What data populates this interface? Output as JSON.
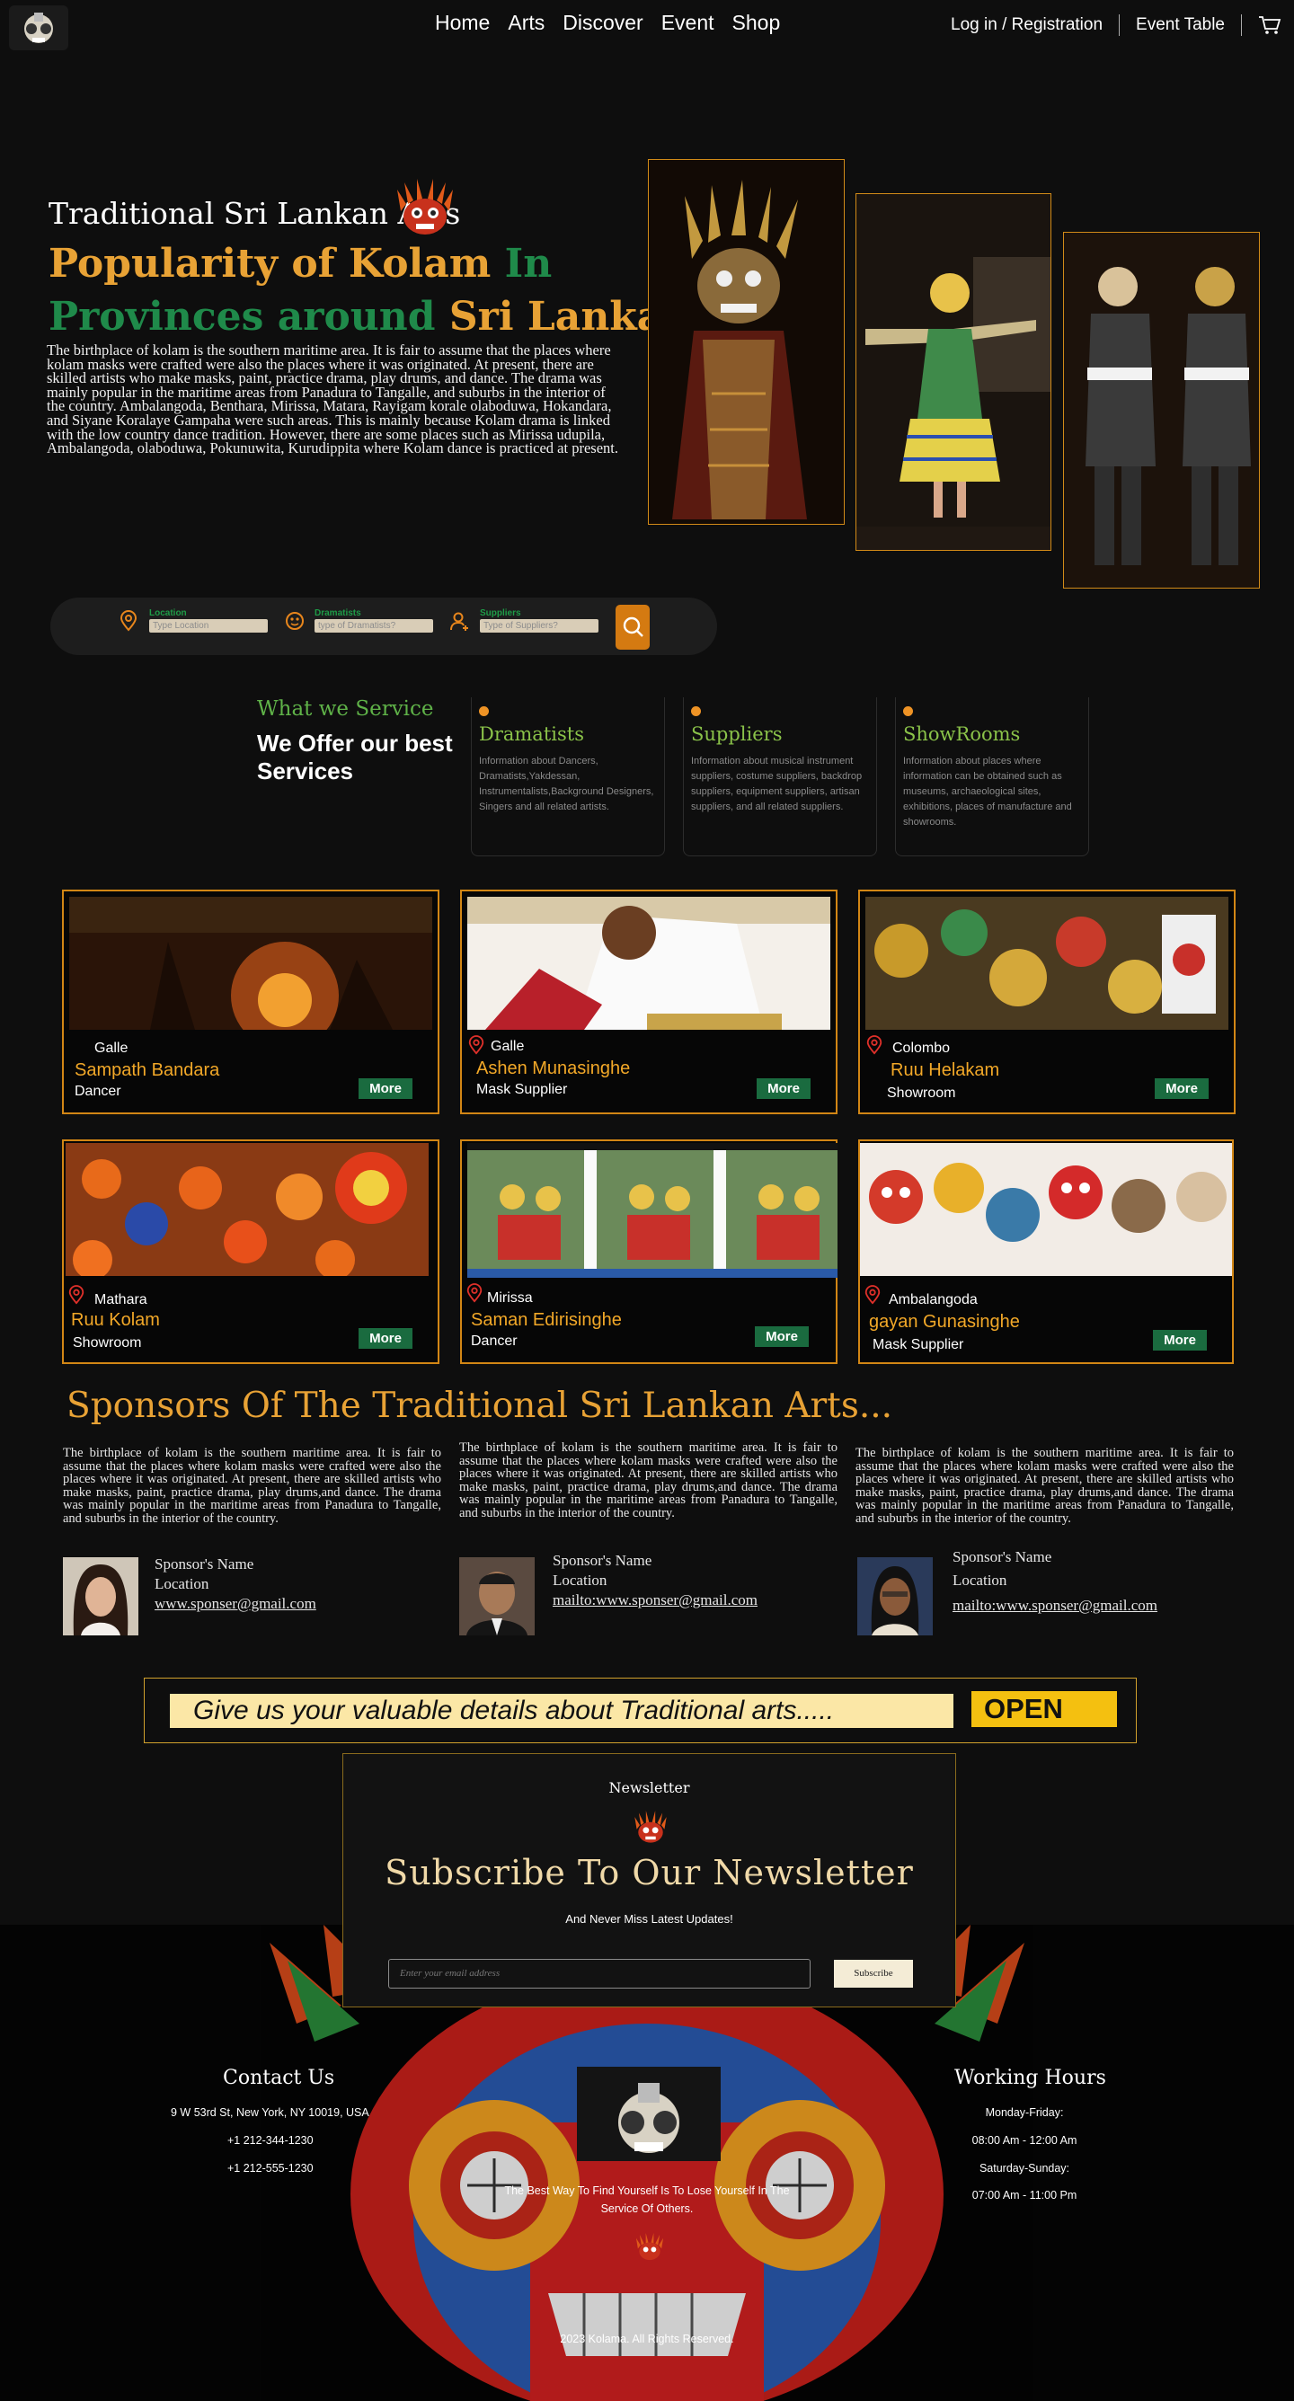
{
  "nav": {
    "links": [
      "Home",
      "Arts",
      "Discover",
      "Event",
      "Shop"
    ],
    "login": "Log in / Registration",
    "event_table": "Event Table"
  },
  "hero": {
    "subtitle": "Traditional Sri Lankan Arts",
    "title_1": "Popularity of Kolam",
    "title_2": "In",
    "title_3": "Provinces around",
    "title_4": "Sri Lanka",
    "paragraph": "The birthplace of kolam is the southern maritime area. It is fair to assume that the places where kolam masks were crafted were also the places where it was originated. At present, there are skilled artists who make masks, paint, practice drama, play drums, and dance. The drama was mainly popular in the maritime areas from Panadura to Tangalle, and suburbs in the interior of the country. Ambalangoda, Benthara, Mirissa, Matara, Rayigam korale olaboduwa, Hokandara, and Siyane Koralaye Gampaha were such areas. This is mainly because Kolam drama is linked with the low country dance tradition. However, there are some places such as Mirissa udupila, Ambalangoda, olaboduwa, Pokunuwita, Kurudippita where Kolam dance is practiced at present."
  },
  "search": {
    "location_label": "Location",
    "location_placeholder": "Type Location",
    "dramatists_label": "Dramatists",
    "dramatists_placeholder": "type of Dramatists?",
    "suppliers_label": "Suppliers",
    "suppliers_placeholder": "Type of Suppliers?"
  },
  "service": {
    "tag": "What we Service",
    "heading": "We Offer our best Services",
    "cards": [
      {
        "title": "Dramatists",
        "text": "Information about Dancers, Dramatists,Yakdessan, Instrumentalists,Background Designers, Singers and all related artists."
      },
      {
        "title": "Suppliers",
        "text": "Information about musical instrument suppliers, costume suppliers, backdrop suppliers, equipment suppliers, artisan suppliers, and all related suppliers."
      },
      {
        "title": "ShowRooms",
        "text": "Information about places where information can be obtained such as museums, archaeological sites, exhibitions, places of manufacture and showrooms."
      }
    ]
  },
  "profiles": [
    {
      "location": "Galle",
      "name": "Sampath Bandara",
      "role": "Dancer",
      "more": "More"
    },
    {
      "location": "Galle",
      "name": "Ashen Munasinghe",
      "role": "Mask Supplier",
      "more": "More"
    },
    {
      "location": "Colombo",
      "name": "Ruu Helakam",
      "role": "Showroom",
      "more": "More"
    },
    {
      "location": "Mathara",
      "name": "Ruu Kolam",
      "role": "Showroom",
      "more": "More"
    },
    {
      "location": "Mirissa",
      "name": "Saman Edirisinghe",
      "role": "Dancer",
      "more": "More"
    },
    {
      "location": "Ambalangoda",
      "name": "gayan Gunasinghe",
      "role": "Mask Supplier",
      "more": "More"
    }
  ],
  "sponsors": {
    "title": "Sponsors Of  The Traditional Sri Lankan Arts...",
    "items": [
      {
        "text": "The birthplace of kolam is the southern maritime area. It is fair to assume that the places where kolam masks were crafted were also the places where it was originated. At present, there are skilled artists who make masks, paint, practice drama, play drums,and dance. The drama was mainly popular in the maritime areas from Panadura to Tangalle, and suburbs in the interior of the country.",
        "name": "Sponsor's Name",
        "location": "Location",
        "email": "www.sponser@gmail.com"
      },
      {
        "text": "The birthplace of kolam is the southern maritime area. It is fair to assume that the places where kolam masks were crafted were also the places where it was originated. At present, there are skilled artists who make masks, paint, practice drama, play drums,and dance. The drama was mainly popular in the maritime areas from Panadura to Tangalle, and suburbs in the interior of the country.",
        "name": "Sponsor's Name",
        "location": "Location",
        "email": "mailto:www.sponser@gmail.com"
      },
      {
        "text": "The birthplace of kolam is the southern maritime area. It is fair to assume that the places where kolam masks were crafted were also the places where it was originated. At present, there are skilled artists who make masks, paint, practice drama, play drums,and dance. The drama was mainly popular in the maritime areas from Panadura to Tangalle, and suburbs in the interior of the country.",
        "name": "Sponsor's Name",
        "location": "Location",
        "email": "mailto:www.sponser@gmail.com"
      }
    ]
  },
  "details": {
    "prompt": "Give us your valuable details about Traditional arts.....",
    "open": "OPEN"
  },
  "newsletter": {
    "label": "Newsletter",
    "title": "Subscribe To Our Newsletter",
    "subtitle": "And Never Miss Latest Updates!",
    "email_placeholder": "Enter your email address",
    "button": "Subscribe"
  },
  "footer": {
    "contact_title": "Contact Us",
    "address": "9 W 53rd St, New York, NY 10019, USA",
    "phone_1": "+1 212-344-1230",
    "phone_2": "+1 212-555-1230",
    "hours_title": "Working Hours",
    "weekday_label": "Monday-Friday:",
    "weekday_hours": "08:00 Am - 12:00 Am",
    "weekend_label": "Saturday-Sunday:",
    "weekend_hours": "07:00 Am - 11:00 Pm",
    "quote": "The Best Way To Find Yourself Is To Lose Yourself In The Service Of Others.",
    "copyright": "2023 Kolama. All Rights Reserved."
  },
  "colors": {
    "accent_orange": "#e8a235",
    "accent_green": "#1f8a4a",
    "background": "#0e0e0e",
    "open_yellow": "#f4c010"
  },
  "icons": [
    "logo-mask-icon",
    "cart-icon",
    "location-pin-icon",
    "dramatist-icon",
    "supplier-icon",
    "search-icon",
    "kolam-mask-icon"
  ]
}
